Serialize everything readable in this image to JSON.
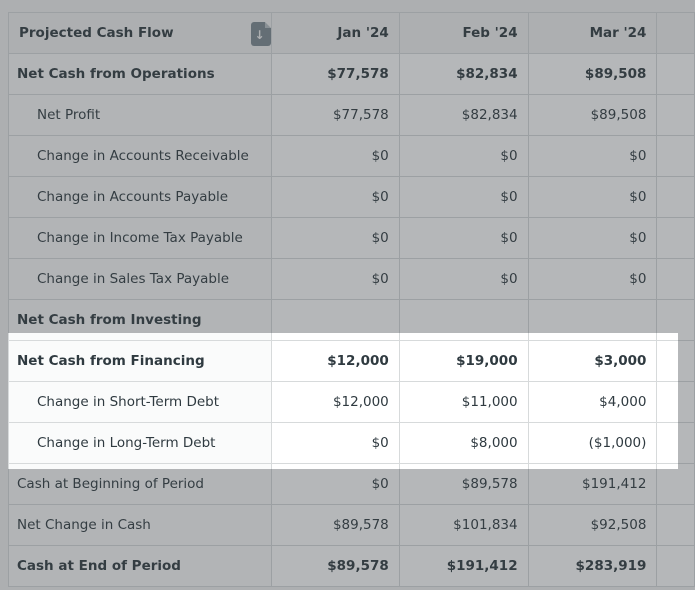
{
  "header": {
    "title": "Projected Cash Flow",
    "export_icon": "download-file-icon",
    "months": [
      "Jan '24",
      "Feb '24",
      "Mar '24"
    ]
  },
  "rows": [
    {
      "label": "Net Cash from Operations",
      "values": [
        "$77,578",
        "$82,834",
        "$89,508"
      ],
      "bold": true,
      "indent": false
    },
    {
      "label": "Net Profit",
      "values": [
        "$77,578",
        "$82,834",
        "$89,508"
      ],
      "bold": false,
      "indent": true
    },
    {
      "label": "Change in Accounts Receivable",
      "values": [
        "$0",
        "$0",
        "$0"
      ],
      "bold": false,
      "indent": true
    },
    {
      "label": "Change in Accounts Payable",
      "values": [
        "$0",
        "$0",
        "$0"
      ],
      "bold": false,
      "indent": true
    },
    {
      "label": "Change in Income Tax Payable",
      "values": [
        "$0",
        "$0",
        "$0"
      ],
      "bold": false,
      "indent": true
    },
    {
      "label": "Change in Sales Tax Payable",
      "values": [
        "$0",
        "$0",
        "$0"
      ],
      "bold": false,
      "indent": true
    },
    {
      "label": "Net Cash from Investing",
      "values": [
        "",
        "",
        ""
      ],
      "bold": true,
      "indent": false
    },
    {
      "label": "Net Cash from Financing",
      "values": [
        "$12,000",
        "$19,000",
        "$3,000"
      ],
      "bold": true,
      "indent": false
    },
    {
      "label": "Change in Short-Term Debt",
      "values": [
        "$12,000",
        "$11,000",
        "$4,000"
      ],
      "bold": false,
      "indent": true
    },
    {
      "label": "Change in Long-Term Debt",
      "values": [
        "$0",
        "$8,000",
        "($1,000)"
      ],
      "bold": false,
      "indent": true
    },
    {
      "label": "Cash at Beginning of Period",
      "values": [
        "$0",
        "$89,578",
        "$191,412"
      ],
      "bold": false,
      "indent": false
    },
    {
      "label": "Net Change in Cash",
      "values": [
        "$89,578",
        "$101,834",
        "$92,508"
      ],
      "bold": false,
      "indent": false
    },
    {
      "label": "Cash at End of Period",
      "values": [
        "$89,578",
        "$191,412",
        "$283,919"
      ],
      "bold": true,
      "indent": false
    }
  ],
  "highlight": {
    "first_row": 7,
    "last_row": 9
  },
  "colors": {
    "overlay": "#3c4246",
    "highlight_bg": "#ffffff",
    "border": "#d7dadb",
    "text": "#2f3a40"
  }
}
